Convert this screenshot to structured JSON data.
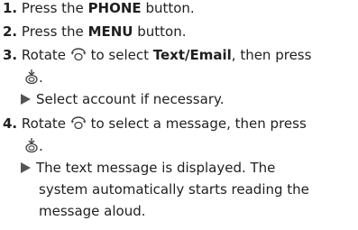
{
  "steps": [
    {
      "num": "1.",
      "pre": "Press the ",
      "bold": "PHONE",
      "post": " button."
    },
    {
      "num": "2.",
      "pre": "Press the ",
      "bold": "MENU",
      "post": " button."
    },
    {
      "num": "3.",
      "pre": "Rotate ",
      "mid": " to select ",
      "bold": "Text/Email",
      "post": ", then press",
      "tail": "."
    },
    {
      "num": "4.",
      "pre": "Rotate ",
      "mid": " to select a message, then press",
      "tail": "."
    }
  ],
  "notes": {
    "step3": "Select account if necessary.",
    "step4_lines": [
      "The text message is displayed. The",
      "system automatically starts reading the",
      "message aloud."
    ]
  },
  "icons": {
    "rotate": "selector-knob-rotate-icon",
    "press": "selector-knob-press-icon"
  }
}
